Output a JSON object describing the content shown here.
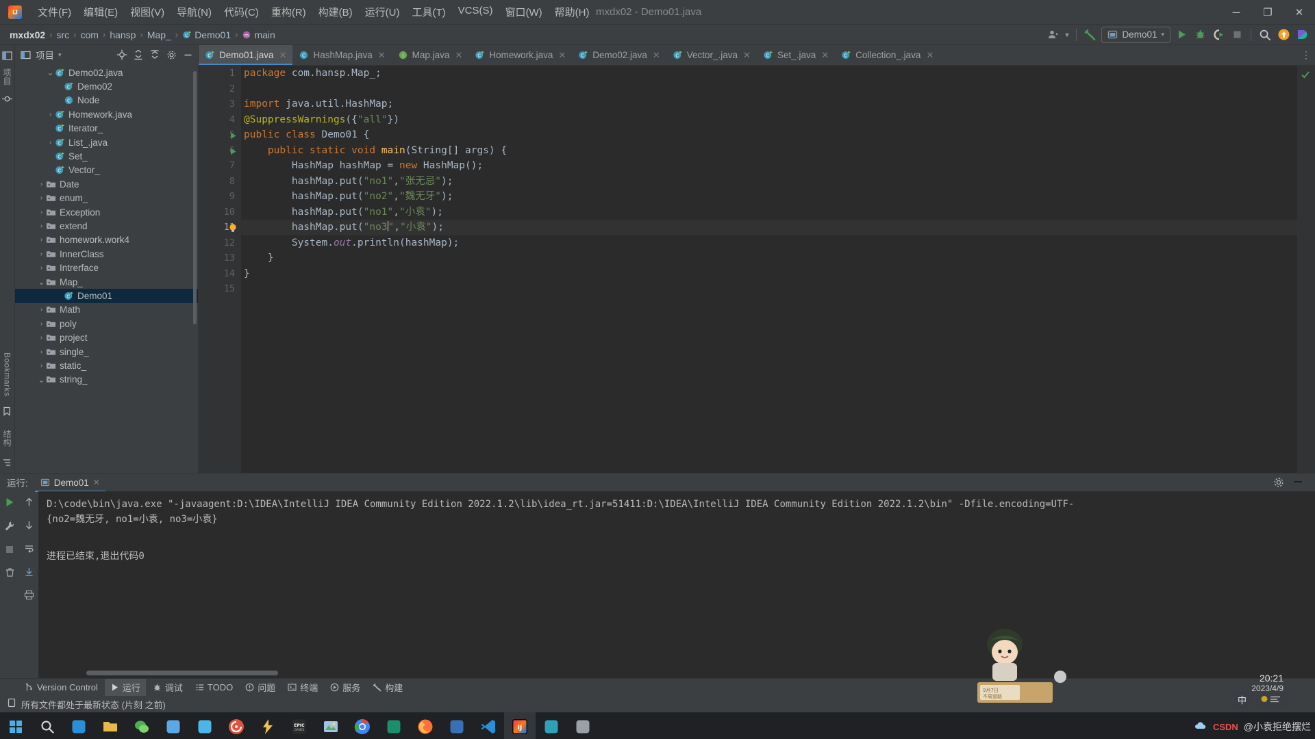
{
  "window": {
    "title": "mxdx02 - Demo01.java",
    "minimize": "─",
    "maximize": "❐",
    "close": "✕"
  },
  "menubar": {
    "items": [
      {
        "label": "文件(F)"
      },
      {
        "label": "编辑(E)"
      },
      {
        "label": "视图(V)"
      },
      {
        "label": "导航(N)"
      },
      {
        "label": "代码(C)"
      },
      {
        "label": "重构(R)"
      },
      {
        "label": "构建(B)"
      },
      {
        "label": "运行(U)"
      },
      {
        "label": "工具(T)"
      },
      {
        "label": "VCS(S)"
      },
      {
        "label": "窗口(W)"
      },
      {
        "label": "帮助(H)"
      }
    ]
  },
  "breadcrumbs": {
    "items": [
      {
        "label": "mxdx02",
        "icon": ""
      },
      {
        "label": "src",
        "icon": ""
      },
      {
        "label": "com",
        "icon": ""
      },
      {
        "label": "hansp",
        "icon": ""
      },
      {
        "label": "Map_",
        "icon": ""
      },
      {
        "label": "Demo01",
        "icon": "class-icon"
      },
      {
        "label": "main",
        "icon": "method-icon"
      }
    ],
    "separator": "›"
  },
  "toolbar": {
    "run_config": "Demo01",
    "dropdown_arrow": "▾",
    "icons": [
      "user-icon",
      "hammer-build-icon",
      "run-icon",
      "debug-icon",
      "run-coverage-icon",
      "stop-icon",
      "search-everywhere-icon",
      "update-icon",
      "idea-assistant-icon"
    ]
  },
  "project_panel": {
    "title": "项目",
    "dropdown": "▾",
    "toolbar_icons": [
      "locate-icon",
      "expand-all-icon",
      "collapse-all-icon",
      "settings-icon",
      "hide-icon"
    ],
    "tree": [
      {
        "label": "Demo02.java",
        "indent": 3,
        "arrow": "⌄",
        "icon": "java-class-runnable",
        "selected": false
      },
      {
        "label": "Demo02",
        "indent": 4,
        "arrow": "",
        "icon": "java-class-runnable",
        "selected": false
      },
      {
        "label": "Node",
        "indent": 4,
        "arrow": "",
        "icon": "java-class",
        "selected": false
      },
      {
        "label": "Homework.java",
        "indent": 3,
        "arrow": "›",
        "icon": "java-class-runnable",
        "selected": false
      },
      {
        "label": "Iterator_",
        "indent": 3,
        "arrow": "",
        "icon": "java-class-runnable",
        "selected": false
      },
      {
        "label": "List_.java",
        "indent": 3,
        "arrow": "›",
        "icon": "java-class-runnable",
        "selected": false
      },
      {
        "label": "Set_",
        "indent": 3,
        "arrow": "",
        "icon": "java-class-runnable",
        "selected": false
      },
      {
        "label": "Vector_",
        "indent": 3,
        "arrow": "",
        "icon": "java-class-runnable",
        "selected": false
      },
      {
        "label": "Date",
        "indent": 2,
        "arrow": "›",
        "icon": "folder",
        "selected": false
      },
      {
        "label": "enum_",
        "indent": 2,
        "arrow": "›",
        "icon": "folder",
        "selected": false
      },
      {
        "label": "Exception",
        "indent": 2,
        "arrow": "›",
        "icon": "folder",
        "selected": false
      },
      {
        "label": "extend",
        "indent": 2,
        "arrow": "›",
        "icon": "folder",
        "selected": false
      },
      {
        "label": "homework.work4",
        "indent": 2,
        "arrow": "›",
        "icon": "folder",
        "selected": false
      },
      {
        "label": "InnerClass",
        "indent": 2,
        "arrow": "›",
        "icon": "folder",
        "selected": false
      },
      {
        "label": "Intrerface",
        "indent": 2,
        "arrow": "›",
        "icon": "folder",
        "selected": false
      },
      {
        "label": "Map_",
        "indent": 2,
        "arrow": "⌄",
        "icon": "folder",
        "selected": false
      },
      {
        "label": "Demo01",
        "indent": 4,
        "arrow": "",
        "icon": "java-class-runnable",
        "selected": true
      },
      {
        "label": "Math",
        "indent": 2,
        "arrow": "›",
        "icon": "folder",
        "selected": false
      },
      {
        "label": "poly",
        "indent": 2,
        "arrow": "›",
        "icon": "folder",
        "selected": false
      },
      {
        "label": "project",
        "indent": 2,
        "arrow": "›",
        "icon": "folder",
        "selected": false
      },
      {
        "label": "single_",
        "indent": 2,
        "arrow": "›",
        "icon": "folder",
        "selected": false
      },
      {
        "label": "static_",
        "indent": 2,
        "arrow": "›",
        "icon": "folder",
        "selected": false
      },
      {
        "label": "string_",
        "indent": 2,
        "arrow": "⌄",
        "icon": "folder",
        "selected": false
      }
    ]
  },
  "left_strip": {
    "labels": [
      "项目",
      "Bookmarks",
      "结构"
    ]
  },
  "editor": {
    "tabs": [
      {
        "label": "Demo01.java",
        "icon": "java-class-runnable",
        "active": true
      },
      {
        "label": "HashMap.java",
        "icon": "java-class",
        "active": false
      },
      {
        "label": "Map.java",
        "icon": "java-interface",
        "active": false
      },
      {
        "label": "Homework.java",
        "icon": "java-class-runnable",
        "active": false
      },
      {
        "label": "Demo02.java",
        "icon": "java-class-runnable",
        "active": false
      },
      {
        "label": "Vector_.java",
        "icon": "java-class-runnable",
        "active": false
      },
      {
        "label": "Set_.java",
        "icon": "java-class-runnable",
        "active": false
      },
      {
        "label": "Collection_.java",
        "icon": "java-class-runnable",
        "active": false
      }
    ],
    "tab_close": "✕",
    "more_tabs": "⋮",
    "line_numbers": [
      "1",
      "2",
      "3",
      "4",
      "5",
      "6",
      "7",
      "8",
      "9",
      "10",
      "11",
      "12",
      "13",
      "14",
      "15"
    ],
    "current_line": 11,
    "inspection_status": "ok-check",
    "code_lines": [
      {
        "n": 1,
        "tokens": [
          {
            "t": "package ",
            "c": "kw"
          },
          {
            "t": "com.hansp.Map_;",
            "c": "plain"
          }
        ]
      },
      {
        "n": 2,
        "tokens": []
      },
      {
        "n": 3,
        "tokens": [
          {
            "t": "import ",
            "c": "kw"
          },
          {
            "t": "java.util.HashMap;",
            "c": "plain"
          }
        ]
      },
      {
        "n": 4,
        "tokens": [
          {
            "t": "@SuppressWarnings",
            "c": "ann"
          },
          {
            "t": "({",
            "c": "plain"
          },
          {
            "t": "\"all\"",
            "c": "str"
          },
          {
            "t": "})",
            "c": "plain"
          }
        ]
      },
      {
        "n": 5,
        "tokens": [
          {
            "t": "public class ",
            "c": "kw"
          },
          {
            "t": "Demo01 {",
            "c": "cls"
          }
        ]
      },
      {
        "n": 6,
        "tokens": [
          {
            "t": "    ",
            "c": "plain"
          },
          {
            "t": "public static void ",
            "c": "kw"
          },
          {
            "t": "main",
            "c": "meth"
          },
          {
            "t": "(String[] args) {",
            "c": "plain"
          }
        ]
      },
      {
        "n": 7,
        "tokens": [
          {
            "t": "        HashMap hashMap = ",
            "c": "plain"
          },
          {
            "t": "new ",
            "c": "kw"
          },
          {
            "t": "HashMap();",
            "c": "plain"
          }
        ]
      },
      {
        "n": 8,
        "tokens": [
          {
            "t": "        hashMap.put(",
            "c": "plain"
          },
          {
            "t": "\"no1\"",
            "c": "str"
          },
          {
            "t": ",",
            "c": "plain"
          },
          {
            "t": "\"张无忌\"",
            "c": "str"
          },
          {
            "t": ");",
            "c": "plain"
          }
        ]
      },
      {
        "n": 9,
        "tokens": [
          {
            "t": "        hashMap.put(",
            "c": "plain"
          },
          {
            "t": "\"no2\"",
            "c": "str"
          },
          {
            "t": ",",
            "c": "plain"
          },
          {
            "t": "\"魏无牙\"",
            "c": "str"
          },
          {
            "t": ");",
            "c": "plain"
          }
        ]
      },
      {
        "n": 10,
        "tokens": [
          {
            "t": "        hashMap.put(",
            "c": "plain"
          },
          {
            "t": "\"no1\"",
            "c": "str"
          },
          {
            "t": ",",
            "c": "plain"
          },
          {
            "t": "\"小袁\"",
            "c": "str"
          },
          {
            "t": ");",
            "c": "plain"
          }
        ]
      },
      {
        "n": 11,
        "tokens": [
          {
            "t": "        hashMap.put(",
            "c": "plain"
          },
          {
            "t": "\"no3",
            "c": "str"
          },
          {
            "t": "CARET",
            "c": "caret"
          },
          {
            "t": "\"",
            "c": "str"
          },
          {
            "t": ",",
            "c": "plain"
          },
          {
            "t": "\"小袁\"",
            "c": "str"
          },
          {
            "t": ");",
            "c": "plain"
          }
        ]
      },
      {
        "n": 12,
        "tokens": [
          {
            "t": "        System.",
            "c": "plain"
          },
          {
            "t": "out",
            "c": "fld"
          },
          {
            "t": ".println(hashMap);",
            "c": "plain"
          }
        ]
      },
      {
        "n": 13,
        "tokens": [
          {
            "t": "    }",
            "c": "plain"
          }
        ]
      },
      {
        "n": 14,
        "tokens": [
          {
            "t": "}",
            "c": "plain"
          }
        ]
      },
      {
        "n": 15,
        "tokens": []
      }
    ]
  },
  "run_panel": {
    "label": "运行:",
    "tab": "Demo01",
    "tab_close": "✕",
    "settings_icon": "gear-icon",
    "minimize_icon": "─",
    "console_lines": [
      "D:\\code\\bin\\java.exe \"-javaagent:D:\\IDEA\\IntelliJ IDEA Community Edition 2022.1.2\\lib\\idea_rt.jar=51411:D:\\IDEA\\IntelliJ IDEA Community Edition 2022.1.2\\bin\" -Dfile.encoding=UTF-",
      "{no2=魏无牙, no1=小袁, no3=小袁}",
      "",
      "进程已结束,退出代码0"
    ],
    "side_icons": [
      "rerun-icon",
      "up-arrow-icon",
      "wrench-icon",
      "down-arrow-icon",
      "stop-icon",
      "soft-wrap-icon",
      "scroll-to-end-icon",
      "print-icon",
      "trash-icon"
    ]
  },
  "tool_window_bar": {
    "items": [
      {
        "label": "Version Control",
        "icon": "branch-icon",
        "active": false
      },
      {
        "label": "运行",
        "icon": "run-icon",
        "active": true
      },
      {
        "label": "调试",
        "icon": "debug-icon",
        "active": false
      },
      {
        "label": "TODO",
        "icon": "todo-icon",
        "active": false
      },
      {
        "label": "问题",
        "icon": "problems-icon",
        "active": false
      },
      {
        "label": "终端",
        "icon": "terminal-icon",
        "active": false
      },
      {
        "label": "服务",
        "icon": "services-icon",
        "active": false
      },
      {
        "label": "构建",
        "icon": "build-icon",
        "active": false
      }
    ]
  },
  "status_bar": {
    "icon": "file-status-icon",
    "text": "所有文件都处于最新状态 (片刻 之前)"
  },
  "taskbar": {
    "start_icon": "windows-start-icon",
    "items": [
      {
        "name": "search-icon",
        "active": false
      },
      {
        "name": "edge-browser-icon",
        "active": false
      },
      {
        "name": "files-icon",
        "active": false
      },
      {
        "name": "weixin-icon",
        "active": false
      },
      {
        "name": "magnifier-app-icon",
        "active": false
      },
      {
        "name": "bird-app-icon",
        "active": false
      },
      {
        "name": "music-app-icon",
        "active": false
      },
      {
        "name": "flash-app-icon",
        "active": false
      },
      {
        "name": "epic-games-icon",
        "active": false
      },
      {
        "name": "photos-icon",
        "active": false
      },
      {
        "name": "chrome-icon",
        "active": false
      },
      {
        "name": "spiral-app-icon",
        "active": false
      },
      {
        "name": "firefox-icon",
        "active": false
      },
      {
        "name": "dev-app-icon",
        "active": false
      },
      {
        "name": "vscode-icon",
        "active": false
      },
      {
        "name": "intellij-idea-icon",
        "active": true
      },
      {
        "name": "edge-dev-icon",
        "active": false
      },
      {
        "name": "snipaste-icon",
        "active": false
      }
    ],
    "tray": {
      "ime_lang": "中",
      "time": "20:21",
      "date": "2023/4/9"
    }
  },
  "watermark": {
    "text": "@小袁拒绝摆烂",
    "csdn": "CSDN"
  },
  "overlay_widget": {
    "date_text": "9月7日 不周道路"
  },
  "colors": {
    "accent_blue": "#4a88c7",
    "editor_bg": "#2b2b2b",
    "panel_bg": "#3c3f41",
    "selection_blue": "#0d293e",
    "string_green": "#6a8759",
    "keyword_orange": "#cc7832",
    "annotation_yellow": "#bbb529",
    "run_green": "#499c54"
  }
}
